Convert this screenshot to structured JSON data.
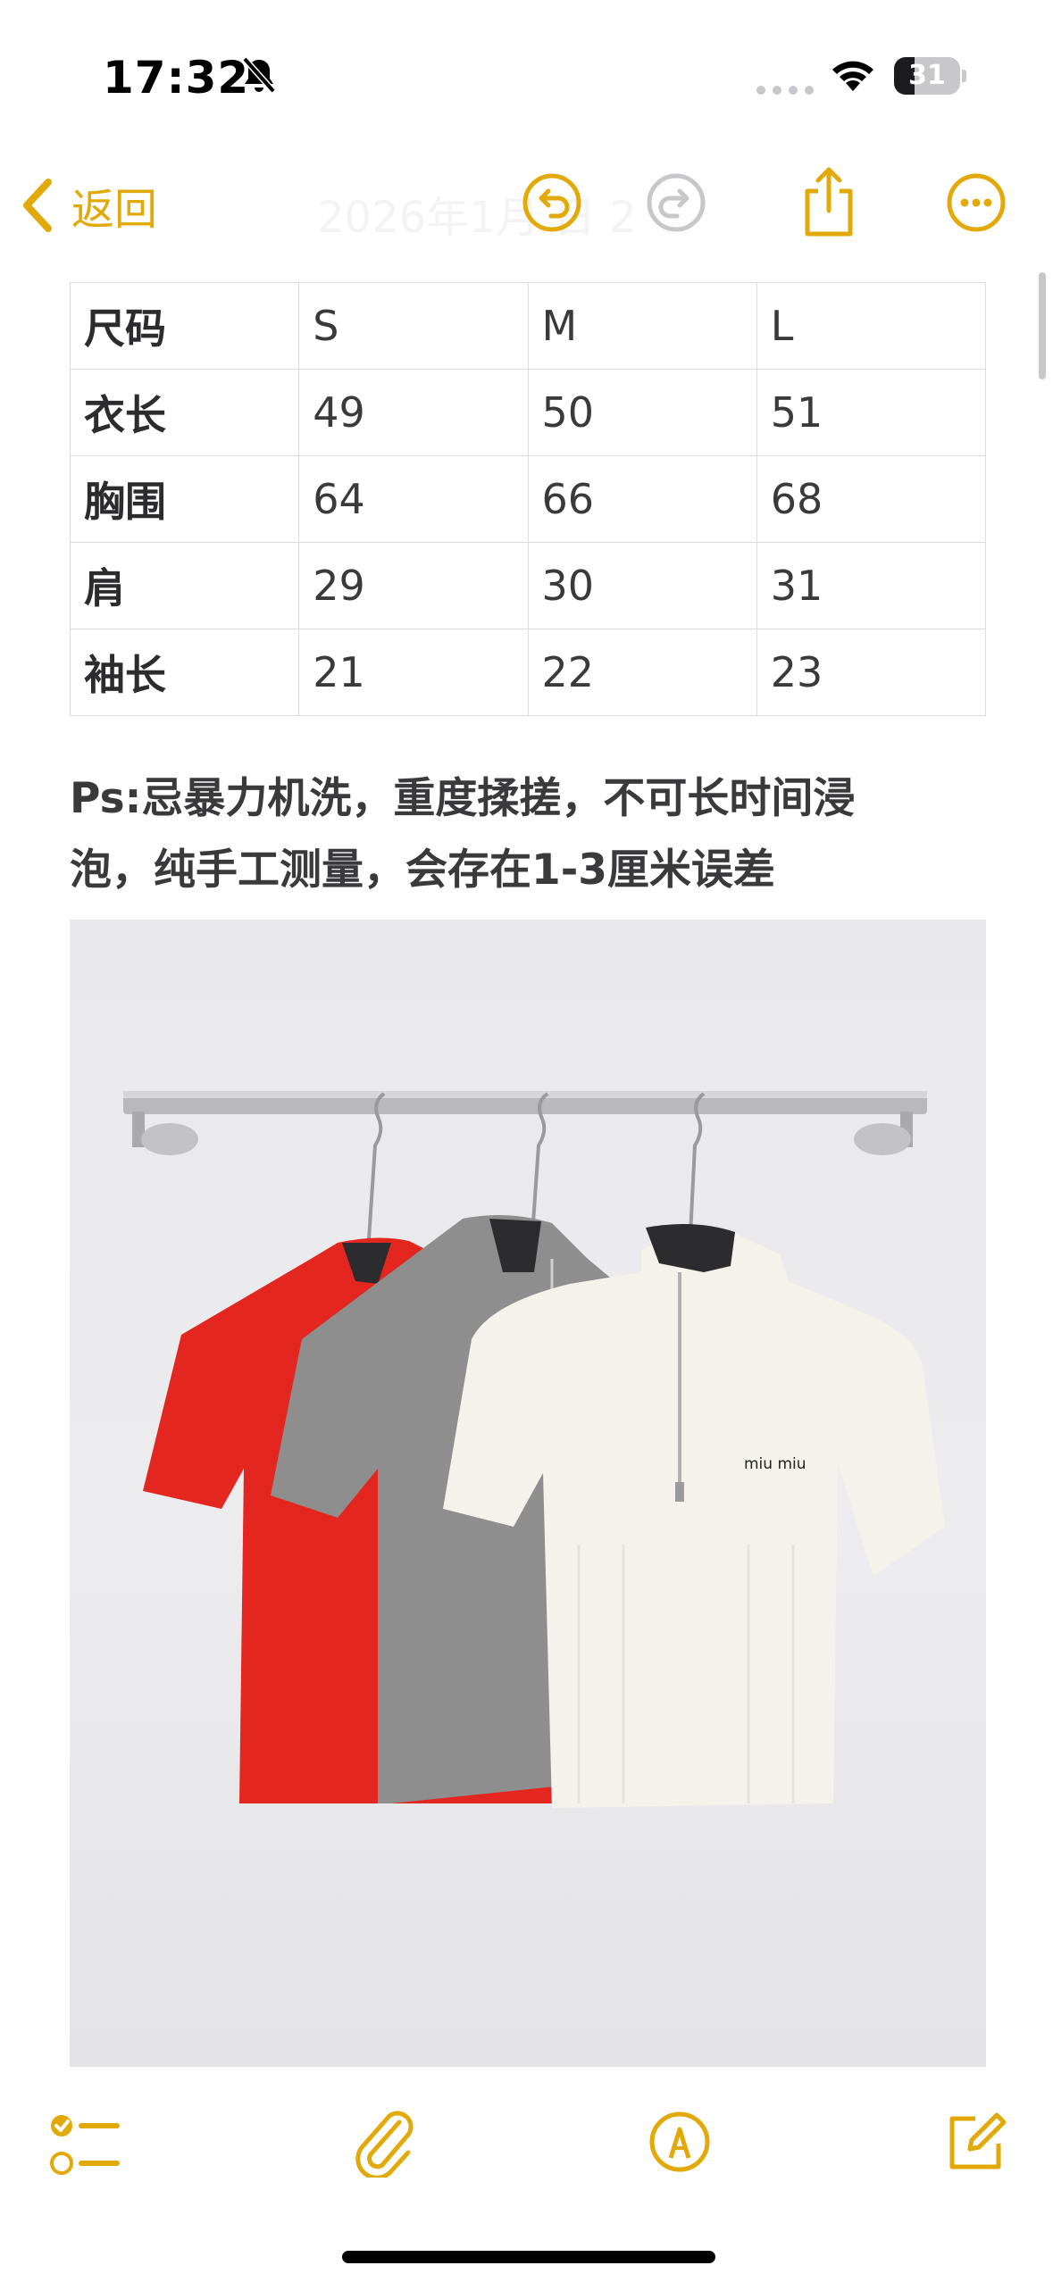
{
  "status_bar": {
    "time": "17:32",
    "battery_level": "31",
    "icons": [
      "bell-slash-icon",
      "cellular-dots-icon",
      "wifi-icon",
      "battery-icon"
    ]
  },
  "nav": {
    "back_label": "返回",
    "title": "2026年1月 日 2",
    "icons": [
      "undo-icon",
      "redo-icon",
      "share-icon",
      "more-icon"
    ]
  },
  "size_table": {
    "headers": [
      "尺码",
      "S",
      "M",
      "L"
    ],
    "rows": [
      [
        "衣长",
        "49",
        "50",
        "51"
      ],
      [
        "胸围",
        "64",
        "66",
        "68"
      ],
      [
        "肩",
        "29",
        "30",
        "31"
      ],
      [
        "袖长",
        "21",
        "22",
        "23"
      ]
    ]
  },
  "note": {
    "line1": "Ps:忌暴力机洗，重度揉搓，不可长时间浸",
    "line2": "泡，纯手工测量，会存在1-3厘米误差"
  },
  "photo": {
    "logo_text": "miu miu",
    "colors": {
      "red": "#e3261f",
      "gray": "#8e8e8e",
      "white": "#f4f2ea"
    }
  },
  "toolbar": {
    "icons": [
      "checklist-icon",
      "paperclip-icon",
      "markup-pen-icon",
      "compose-icon"
    ]
  },
  "theme": {
    "accent": "#e2a90a"
  }
}
